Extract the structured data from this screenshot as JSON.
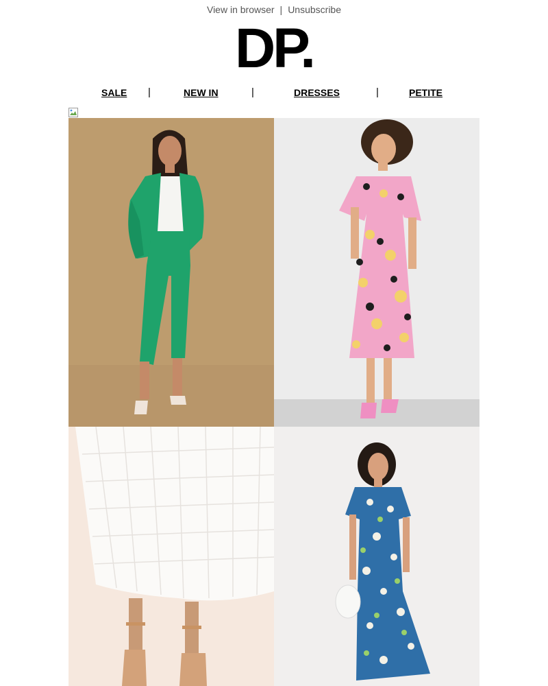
{
  "header": {
    "view_in_browser": "View in browser",
    "separator": "|",
    "unsubscribe": "Unsubscribe"
  },
  "brand": {
    "logo_text": "DP."
  },
  "nav": {
    "items": [
      {
        "label": "SALE"
      },
      {
        "label": "NEW IN"
      },
      {
        "label": "DRESSES"
      },
      {
        "label": "PETITE"
      }
    ],
    "separator": "|"
  },
  "colors": {
    "suit_green": "#1fa36b",
    "tile1_bg": "#bd9c6e",
    "tile2_bg": "#ececec",
    "tile3_bg": "#f6e8de",
    "tile4_bg": "#f1efee",
    "floral_pink": "#f2a6c8",
    "floral_yellow": "#f3d16a",
    "floral_blue": "#2f6fa8"
  },
  "images": [
    {
      "icon": "broken-image-icon"
    },
    {
      "subject": "model-green-suit"
    },
    {
      "subject": "model-pink-floral-dress"
    },
    {
      "subject": "white-textured-skirt-closeup"
    },
    {
      "subject": "model-blue-floral-dress"
    }
  ]
}
